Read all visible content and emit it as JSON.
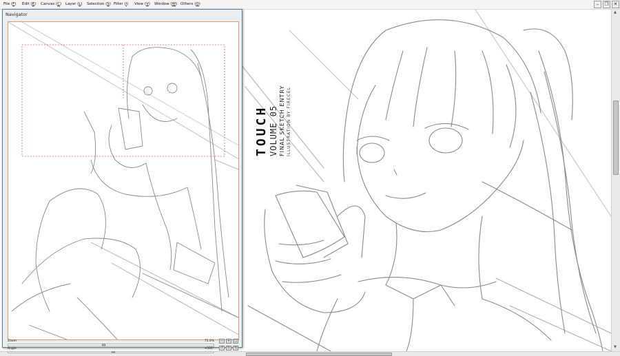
{
  "menubar": {
    "items": [
      {
        "label": "File",
        "key": "F"
      },
      {
        "label": "Edit",
        "key": "E"
      },
      {
        "label": "Canvas",
        "key": "C"
      },
      {
        "label": "Layer",
        "key": "L"
      },
      {
        "label": "Selection",
        "key": "S"
      },
      {
        "label": "Filter",
        "key": "I"
      },
      {
        "label": "View",
        "key": "V"
      },
      {
        "label": "Window",
        "key": "W"
      },
      {
        "label": "Others",
        "key": "O"
      }
    ],
    "window_buttons": {
      "minimize": "–",
      "restore": "❐",
      "close": "✕"
    }
  },
  "artwork_title": {
    "line1": "TOUCH",
    "line2": "VOLUME 05",
    "line3": "FINAL SKETCH ENTRY",
    "line4": "ILLUSTRATION BY FIRECEL"
  },
  "navigator": {
    "title": "Navigator",
    "zoom_label": "Zoom",
    "zoom_value": "75.0%",
    "angle_label": "Angle",
    "angle_value": "+000°",
    "buttons": {
      "zoom_out": "−",
      "zoom_in": "+",
      "fit": "□",
      "angle_left": "↺",
      "angle_right": "↻",
      "angle_reset": "⟲"
    }
  },
  "colors": {
    "accent": "#e29a72",
    "viewport_frame": "#e05a8a",
    "panel_border": "#5d7c87",
    "sketch_line": "#7a7a7a"
  }
}
